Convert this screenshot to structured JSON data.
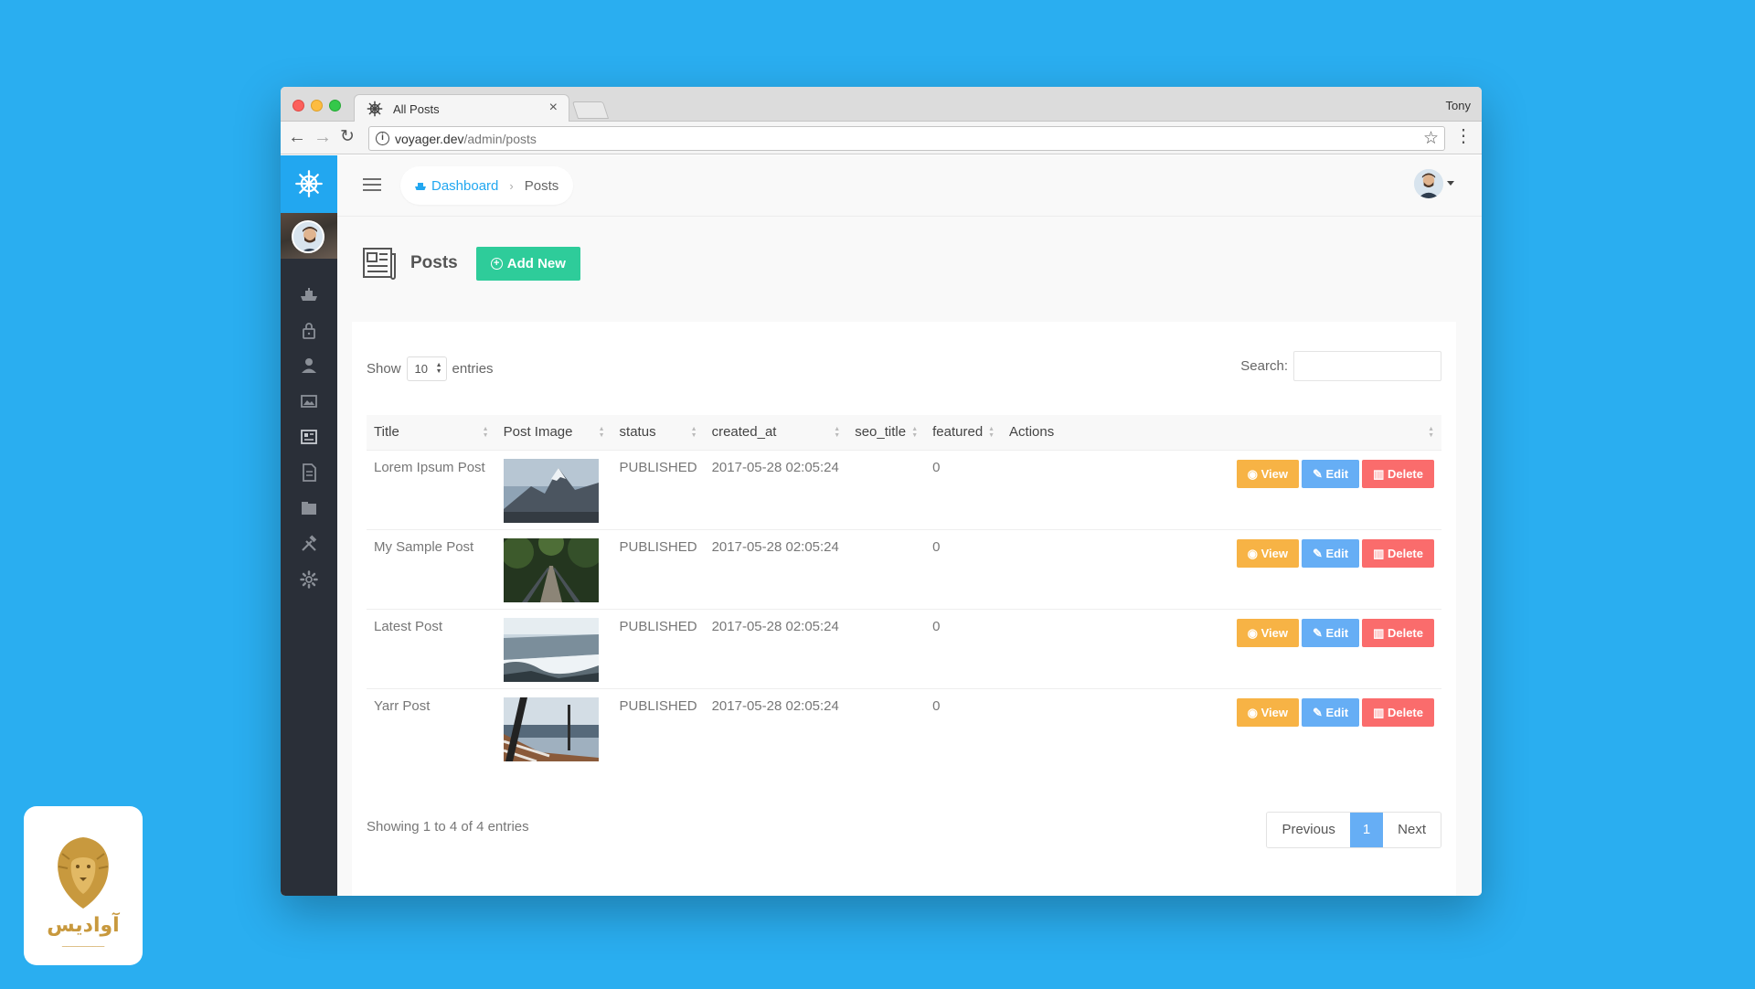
{
  "browser": {
    "tab_title": "All Posts",
    "profile_name": "Tony",
    "url_host": "voyager.dev",
    "url_path": "/admin/posts"
  },
  "icons": {
    "brand": "ship-wheel-icon",
    "sidebar": [
      "dashboard-icon",
      "lock-icon",
      "user-icon",
      "media-icon",
      "posts-icon",
      "pages-icon",
      "categories-icon",
      "tools-icon",
      "settings-icon"
    ]
  },
  "colors": {
    "primary": "#22a7f0",
    "add_new": "#2ecc9a",
    "view": "#f7b345",
    "edit": "#66aef5",
    "delete": "#fa6c6c",
    "sidebar": "#2a2f38"
  },
  "breadcrumb": {
    "home": "Dashboard",
    "current": "Posts"
  },
  "page": {
    "title": "Posts",
    "add_new": "Add New"
  },
  "table_controls": {
    "show_label": "Show",
    "entries_value": "10",
    "entries_label": "entries",
    "search_label": "Search:"
  },
  "table": {
    "headers": [
      "Title",
      "Post Image",
      "status",
      "created_at",
      "seo_title",
      "featured",
      "Actions"
    ],
    "rows": [
      {
        "title": "Lorem Ipsum Post",
        "status": "PUBLISHED",
        "created_at": "2017-05-28 02:05:24",
        "seo_title": "",
        "featured": "0"
      },
      {
        "title": "My Sample Post",
        "status": "PUBLISHED",
        "created_at": "2017-05-28 02:05:24",
        "seo_title": "",
        "featured": "0"
      },
      {
        "title": "Latest Post",
        "status": "PUBLISHED",
        "created_at": "2017-05-28 02:05:24",
        "seo_title": "",
        "featured": "0"
      },
      {
        "title": "Yarr Post",
        "status": "PUBLISHED",
        "created_at": "2017-05-28 02:05:24",
        "seo_title": "",
        "featured": "0"
      }
    ],
    "actions": {
      "view": "View",
      "edit": "Edit",
      "delete": "Delete"
    }
  },
  "footer": {
    "showing": "Showing 1 to 4 of 4 entries",
    "previous": "Previous",
    "page": "1",
    "next": "Next"
  },
  "watermark": {
    "name": "آوادیس"
  }
}
